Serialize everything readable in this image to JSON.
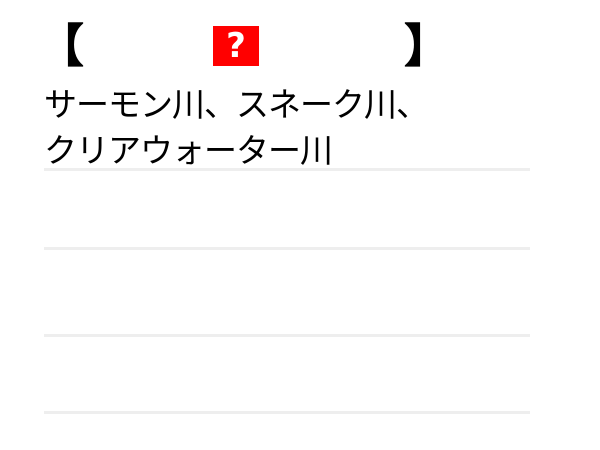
{
  "header": {
    "left_bracket": "【",
    "right_bracket": "】",
    "icon": "question-mark-icon",
    "icon_symbol": "?",
    "icon_color": "#ff0000"
  },
  "answer": {
    "text": "サーモン川、スネーク川、\nクリアウォーター川"
  }
}
